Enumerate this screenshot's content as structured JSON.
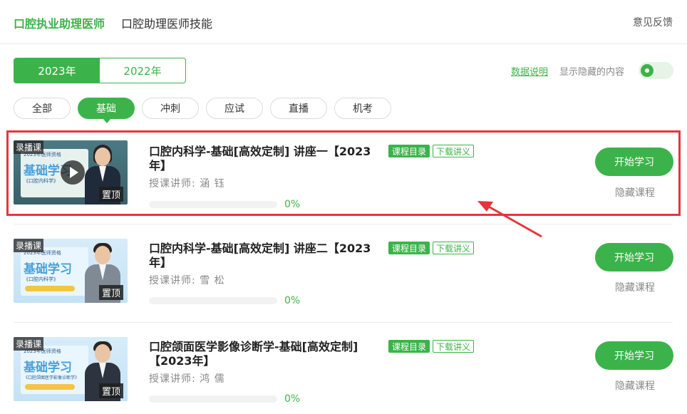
{
  "top_tabs": {
    "active": "口腔执业助理医师",
    "second": "口腔助理医师技能"
  },
  "feedback": "意见反馈",
  "years": [
    "2023年",
    "2022年"
  ],
  "data_note": "数据说明",
  "show_hidden_label": "显示隐藏的内容",
  "filters": [
    "全部",
    "基础",
    "冲刺",
    "应试",
    "直播",
    "机考"
  ],
  "accent_color": "#3cb34a",
  "highlight_color": "#e4363b",
  "course_common": {
    "recorded_tag": "录播课",
    "pinned_tag": "置顶",
    "catalog_label": "课程目录",
    "download_label": "下载讲义",
    "start_label": "开始学习",
    "hide_label": "隐藏课程"
  },
  "courses": [
    {
      "title": "口腔内科学-基础[高效定制] 讲座一【2023年】",
      "teacher": "授课讲师:  涵  钰",
      "progress_text": "0%",
      "progress_fraction": 0,
      "thumb": {
        "top": "2023年医师资格",
        "title": "基础学习",
        "sub": "《口腔内科学》"
      }
    },
    {
      "title": "口腔内科学-基础[高效定制] 讲座二【2023年】",
      "teacher": "授课讲师:  雪  松",
      "progress_text": "0%",
      "progress_fraction": 0,
      "thumb": {
        "top": "2023年医师资格",
        "title": "基础学习",
        "sub": "《口腔内科学》"
      }
    },
    {
      "title": "口腔颌面医学影像诊断学-基础[高效定制]【2023年】",
      "teacher": "授课讲师:  鸿  儒",
      "progress_text": "0%",
      "progress_fraction": 0,
      "thumb": {
        "top": "2023年医师资格",
        "title": "基础学习",
        "sub": "《口腔颌面医学影像诊断学》"
      }
    }
  ]
}
